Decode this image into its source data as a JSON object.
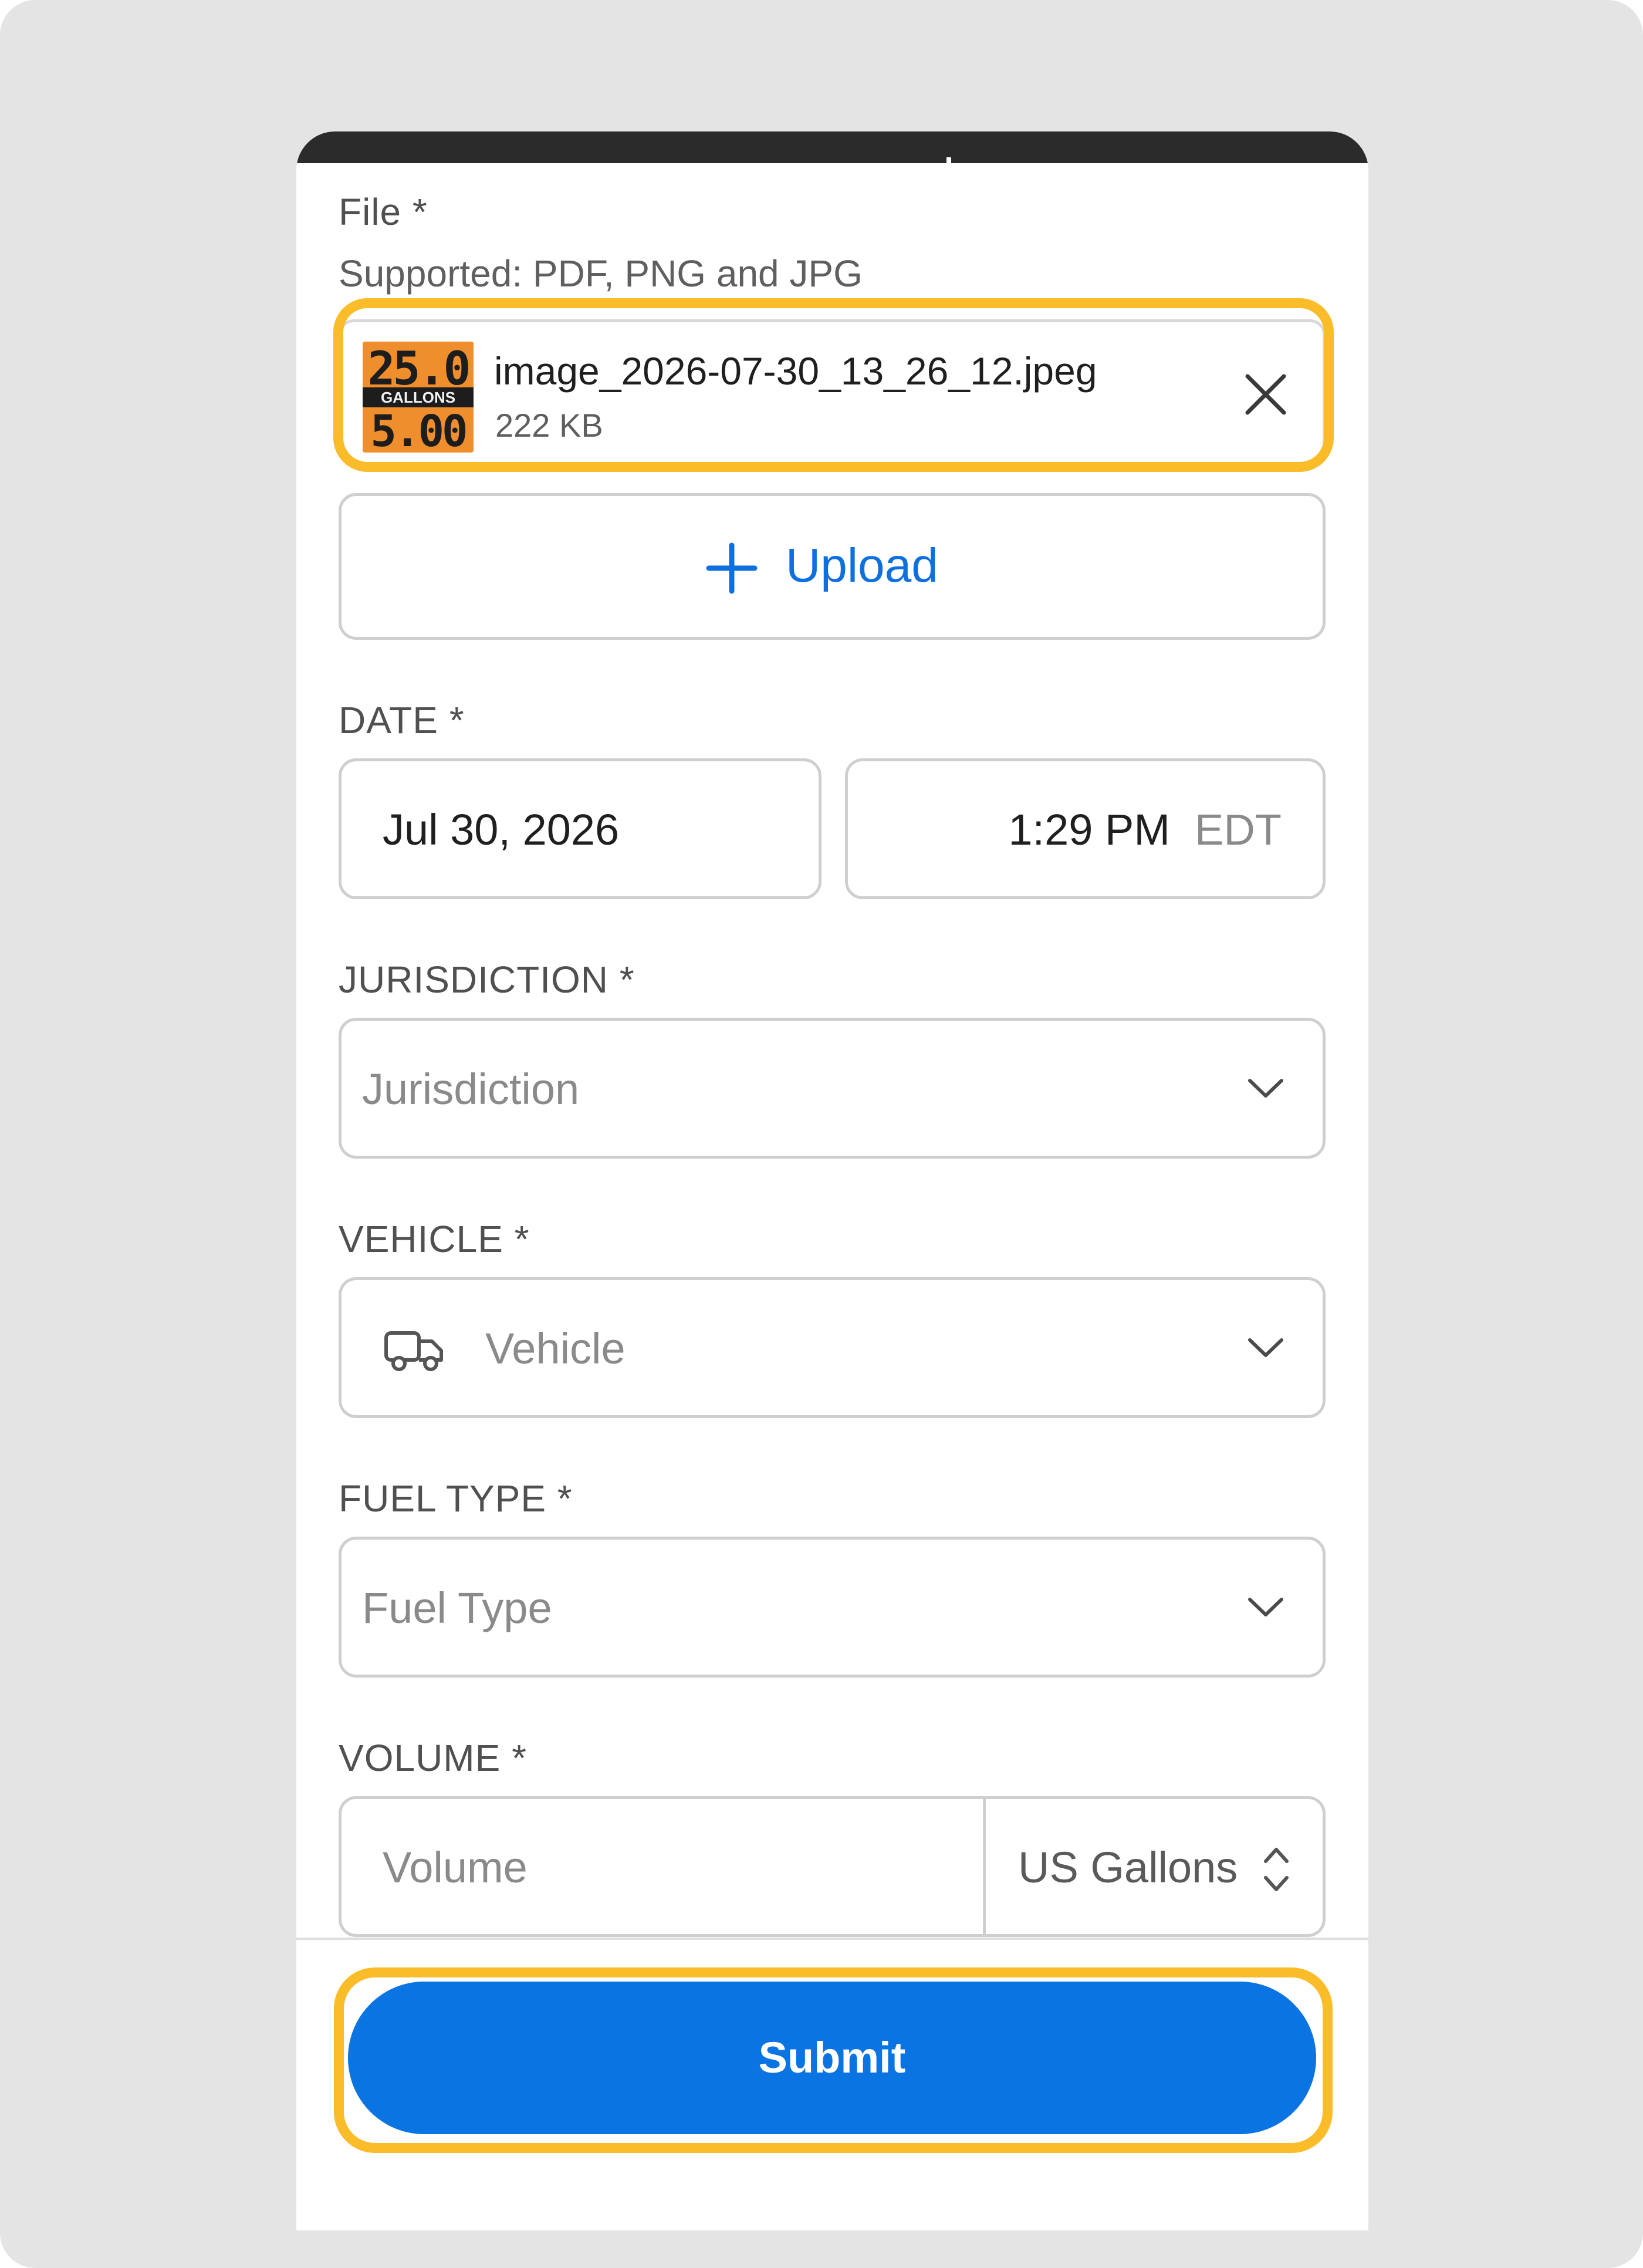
{
  "form": {
    "file_label": "File *",
    "file_supported": "Supported: PDF, PNG and JPG",
    "attachment": {
      "name": "image_2026-07-30_13_26_12.jpeg",
      "size": "222 KB",
      "thumbnail_top": "25.0",
      "thumbnail_band": "GALLONS",
      "thumbnail_bottom": "5.00"
    },
    "upload_label": "Upload",
    "date_label": "DATE *",
    "date_value": "Jul 30, 2026",
    "time_value": "1:29 PM",
    "timezone": "EDT",
    "jurisdiction_label": "JURISDICTION *",
    "jurisdiction_placeholder": "Jurisdiction",
    "vehicle_label": "VEHICLE *",
    "vehicle_placeholder": "Vehicle",
    "fuel_type_label": "FUEL TYPE *",
    "fuel_type_placeholder": "Fuel Type",
    "volume_label": "VOLUME *",
    "volume_placeholder": "Volume",
    "volume_unit": "US Gallons",
    "submit_label": "Submit"
  },
  "colors": {
    "accent": "#0a74e2",
    "highlight": "#fbbc2a",
    "background": "#e4e4e4"
  },
  "icons": [
    "close-icon",
    "plus-icon",
    "truck-icon",
    "chevron-down-icon",
    "sort-arrows-icon"
  ]
}
